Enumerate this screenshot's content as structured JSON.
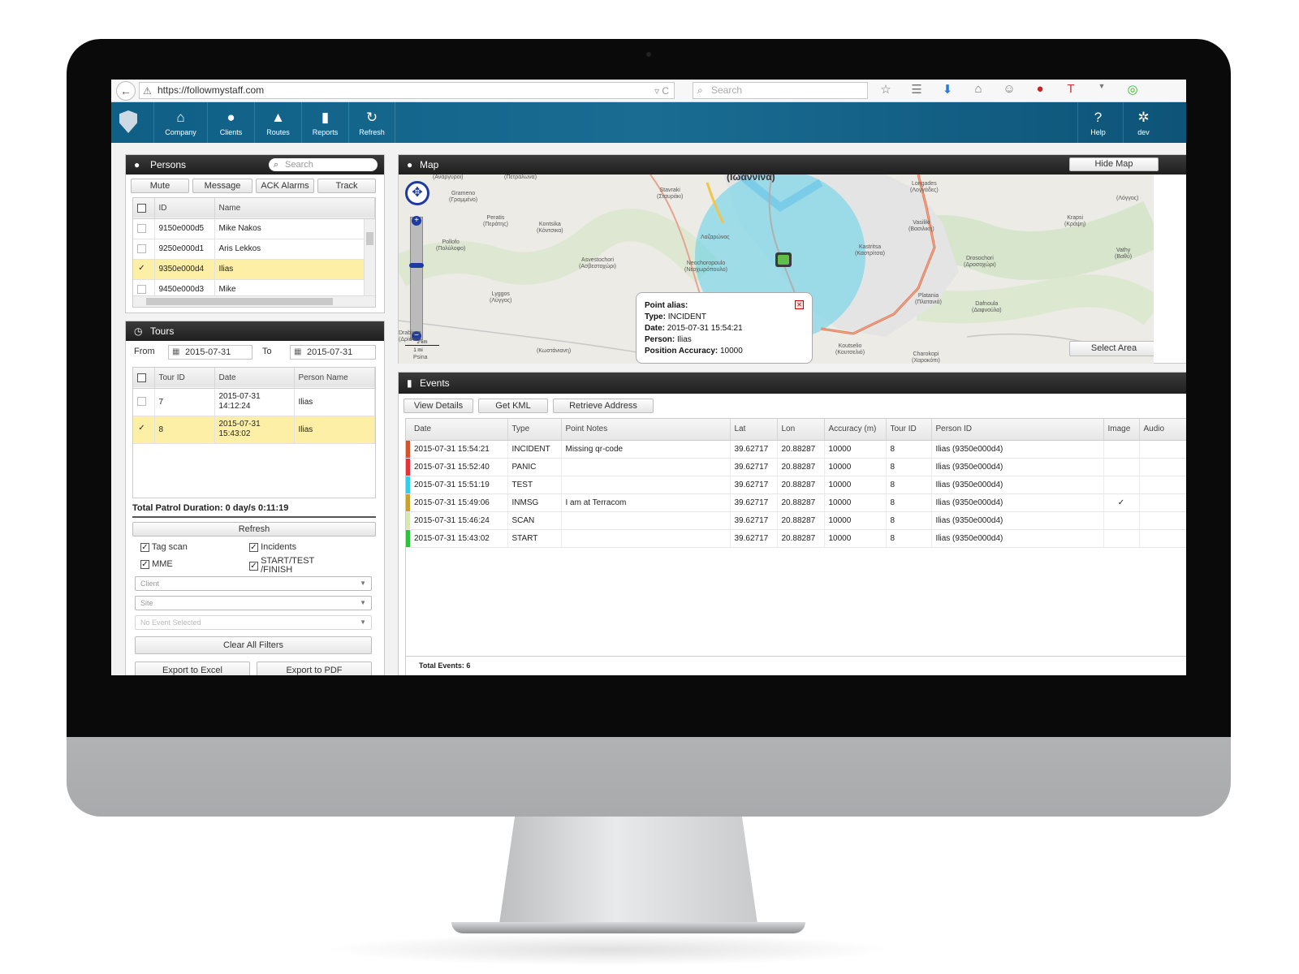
{
  "browser": {
    "url": "https://followmystaff.com",
    "search_placeholder": "Search",
    "url_tools": "▿ C"
  },
  "nav": {
    "items": [
      {
        "label": "Company",
        "icon": "home-icon"
      },
      {
        "label": "Clients",
        "icon": "user-icon"
      },
      {
        "label": "Routes",
        "icon": "road-icon"
      },
      {
        "label": "Reports",
        "icon": "bar-chart-icon"
      },
      {
        "label": "Refresh",
        "icon": "refresh-icon"
      }
    ],
    "right_items": [
      {
        "label": "Help",
        "icon": "help-icon"
      },
      {
        "label": "dev",
        "icon": "gear-icon"
      }
    ]
  },
  "persons": {
    "title": "Persons",
    "search_placeholder": "Search",
    "buttons": {
      "mute": "Mute",
      "message": "Message",
      "ack": "ACK Alarms",
      "track": "Track"
    },
    "columns": {
      "id": "ID",
      "name": "Name"
    },
    "rows": [
      {
        "id": "9150e000d5",
        "name": "Mike Nakos",
        "checked": false
      },
      {
        "id": "9250e000d1",
        "name": "Aris Lekkos",
        "checked": false
      },
      {
        "id": "9350e000d4",
        "name": "Ilias",
        "checked": true
      },
      {
        "id": "9450e000d3",
        "name": "Mike",
        "checked": false
      }
    ]
  },
  "tours": {
    "title": "Tours",
    "from_label": "From",
    "from_value": "2015-07-31",
    "to_label": "To",
    "to_value": "2015-07-31",
    "columns": {
      "tour_id": "Tour ID",
      "date": "Date",
      "person": "Person Name"
    },
    "rows": [
      {
        "tour_id": "7",
        "date1": "2015-07-31",
        "date2": "14:12:24",
        "person": "Ilias",
        "checked": false
      },
      {
        "tour_id": "8",
        "date1": "2015-07-31",
        "date2": "15:43:02",
        "person": "Ilias",
        "checked": true
      }
    ],
    "total": "Total Patrol Duration: 0 day/s 0:11:19",
    "refresh": "Refresh",
    "filters": {
      "tag_scan": "Tag scan",
      "incidents": "Incidents",
      "mme": "MME",
      "start_test_1": "START/TEST",
      "start_test_2": "/FINISH"
    },
    "selects": {
      "client": "Client",
      "site": "Site",
      "event": "No Event Selected"
    },
    "clear": "Clear All Filters",
    "export_excel": "Export to Excel",
    "export_pdf": "Export to PDF"
  },
  "map": {
    "title": "Map",
    "hide": "Hide Map",
    "select_area": "Select Area",
    "scale_km": "2 km",
    "scale_mi": "1 mi",
    "city": "(Ιωάννινα)",
    "labels": [
      {
        "text": "(Ανάργυροι)"
      },
      {
        "text": "(Πετράλωνα)"
      },
      {
        "text": "Grameno\n(Γραμμένο)"
      },
      {
        "text": "Stavraki\n(Σταυράκι)"
      },
      {
        "text": "Peratis\n(Περάτης)"
      },
      {
        "text": "Kontsika\n(Κόντσικα)"
      },
      {
        "text": "Pollofo\n(Πολύλοφο)"
      },
      {
        "text": "Asvestochori\n(Ασβεστοχώρι)"
      },
      {
        "text": "Neochoropoulo\n(Νεοχωρόπουλο)"
      },
      {
        "text": "Lyggos\n(Λύγγος)"
      },
      {
        "text": "Longades\n(Λογγάδες)"
      },
      {
        "text": "Vasiliki\n(Βασιλική)"
      },
      {
        "text": "Krapsi\n(Κράψη)"
      },
      {
        "text": "Kastritsa\n(Καστρίτσα)"
      },
      {
        "text": "Drosochori\n(Δροσοχώρι)"
      },
      {
        "text": "Vathy\n(Βαθύ)"
      },
      {
        "text": "Platania\n(Πλατανιά)"
      },
      {
        "text": "Dafnoula\n(Δαφνούλα)"
      },
      {
        "text": "Koutselio\n(Κουτσελιό)"
      },
      {
        "text": "Charokopi\n(Χαροκόπι)"
      },
      {
        "text": "(Κωστάνιανη)"
      },
      {
        "text": "Psina"
      },
      {
        "text": "Drabissa\n(Δρίσσα)"
      },
      {
        "text": "(Λόγγος)"
      },
      {
        "text": "Λαζαρώνος"
      }
    ],
    "popup": {
      "alias_label": "Point alias:",
      "type_label": "Type:",
      "type_value": "INCIDENT",
      "date_label": "Date:",
      "date_value": "2015-07-31 15:54:21",
      "person_label": "Person:",
      "person_value": "Ilias",
      "accuracy_label": "Position Accuracy:",
      "accuracy_value": "10000"
    }
  },
  "events": {
    "title": "Events",
    "buttons": {
      "view": "View Details",
      "kml": "Get KML",
      "address": "Retrieve Address"
    },
    "columns": {
      "date": "Date",
      "type": "Type",
      "notes": "Point Notes",
      "lat": "Lat",
      "lon": "Lon",
      "accuracy": "Accuracy (m)",
      "tour": "Tour ID",
      "person": "Person ID",
      "image": "Image",
      "audio": "Audio"
    },
    "rows": [
      {
        "color": "#d2532c",
        "date": "2015-07-31 15:54:21",
        "type": "INCIDENT",
        "notes": "Missing qr-code",
        "lat": "39.62717",
        "lon": "20.88287",
        "accuracy": "10000",
        "tour": "8",
        "person": "Ilias (9350e000d4)",
        "image": ""
      },
      {
        "color": "#e8303a",
        "date": "2015-07-31 15:52:40",
        "type": "PANIC",
        "notes": "",
        "lat": "39.62717",
        "lon": "20.88287",
        "accuracy": "10000",
        "tour": "8",
        "person": "Ilias (9350e000d4)",
        "image": ""
      },
      {
        "color": "#2fd0e8",
        "date": "2015-07-31 15:51:19",
        "type": "TEST",
        "notes": "",
        "lat": "39.62717",
        "lon": "20.88287",
        "accuracy": "10000",
        "tour": "8",
        "person": "Ilias (9350e000d4)",
        "image": ""
      },
      {
        "color": "#c9a22a",
        "date": "2015-07-31 15:49:06",
        "type": "INMSG",
        "notes": "I am at Terracom",
        "lat": "39.62717",
        "lon": "20.88287",
        "accuracy": "10000",
        "tour": "8",
        "person": "Ilias (9350e000d4)",
        "image": "✓"
      },
      {
        "color": "#d6e9b0",
        "date": "2015-07-31 15:46:24",
        "type": "SCAN",
        "notes": "",
        "lat": "39.62717",
        "lon": "20.88287",
        "accuracy": "10000",
        "tour": "8",
        "person": "Ilias (9350e000d4)",
        "image": ""
      },
      {
        "color": "#2fc23c",
        "date": "2015-07-31 15:43:02",
        "type": "START",
        "notes": "",
        "lat": "39.62717",
        "lon": "20.88287",
        "accuracy": "10000",
        "tour": "8",
        "person": "Ilias (9350e000d4)",
        "image": ""
      }
    ],
    "total": "Total Events: 6"
  }
}
